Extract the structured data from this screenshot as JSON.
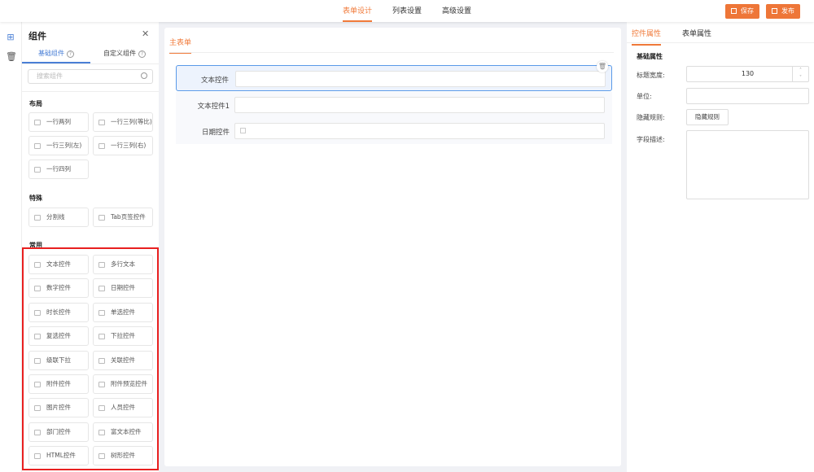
{
  "topbar": {
    "tabs": [
      "表单设计",
      "列表设置",
      "高级设置"
    ],
    "save": "保存",
    "publish": "发布"
  },
  "sidebar": {
    "title": "组件",
    "tabs": [
      "基础组件",
      "自定义组件"
    ],
    "search_placeholder": "搜索组件",
    "sections": [
      {
        "title": "布局",
        "items": [
          "一行两列",
          "一行三列(等比)",
          "一行三列(左)",
          "一行三列(右)",
          "一行四列"
        ]
      },
      {
        "title": "特殊",
        "items": [
          "分割线",
          "Tab页签控件"
        ]
      },
      {
        "title": "常用",
        "items": [
          "文本控件",
          "多行文本",
          "数字控件",
          "日期控件",
          "时长控件",
          "单选控件",
          "复选控件",
          "下拉控件",
          "级联下拉",
          "关联控件",
          "附件控件",
          "附件预览控件",
          "图片控件",
          "人员控件",
          "部门控件",
          "富文本控件",
          "HTML控件",
          "树形控件"
        ]
      }
    ]
  },
  "canvas": {
    "tab": "主表单",
    "fields": [
      {
        "label": "文本控件",
        "selected": true
      },
      {
        "label": "文本控件1"
      },
      {
        "label": "日期控件"
      }
    ]
  },
  "props": {
    "tabs": [
      "控件属性",
      "表单属性"
    ],
    "section": "基础属性",
    "title_width_label": "标题宽度:",
    "title_width": "130",
    "unit_label": "单位:",
    "hide_label": "隐藏规则:",
    "hide_button": "隐藏规则",
    "desc_label": "字段描述:"
  },
  "colors": {
    "accent": "#ee7638",
    "blue": "#4a7fd6"
  }
}
